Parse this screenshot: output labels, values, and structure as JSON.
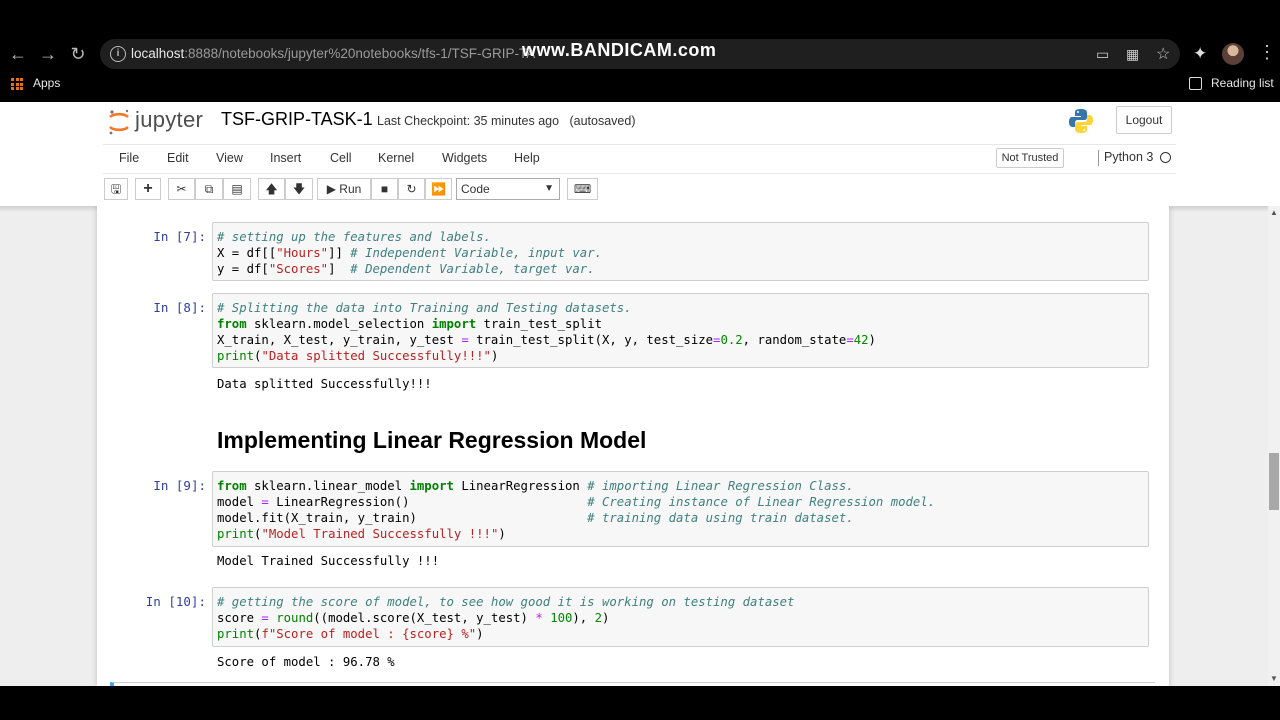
{
  "browser": {
    "url_host": "localhost",
    "url_rest": ":8888/notebooks/jupyter%20notebooks/tfs-1/TSF-GRIP-TA",
    "watermark": "www.BANDICAM.com",
    "bookmarks_apps": "Apps",
    "reading_list": "Reading list",
    "icons": [
      "back-arrow-icon",
      "forward-arrow-icon",
      "reload-icon",
      "site-info-icon",
      "cast-icon",
      "qr-code-icon",
      "bookmark-star-icon",
      "extensions-puzzle-icon",
      "profile-avatar",
      "menu-kebab-icon"
    ]
  },
  "jupyter": {
    "logo_text": "jupyter",
    "notebook_name": "TSF-GRIP-TASK-1",
    "checkpoint": "Last Checkpoint: 35 minutes ago",
    "autosave": "(autosaved)",
    "logout": "Logout",
    "menu": [
      "File",
      "Edit",
      "View",
      "Insert",
      "Cell",
      "Kernel",
      "Widgets",
      "Help"
    ],
    "trust": "Not Trusted",
    "kernel": "Python 3",
    "run_label": "Run",
    "cell_type": "Code"
  },
  "cells": {
    "c7": {
      "prompt": "In [7]:",
      "lines": [
        "# setting up the features and labels.",
        "X = df[[\"Hours\"]] # Independent Variable, input var.",
        "y = df[\"Scores\"]  # Dependent Variable, target var."
      ]
    },
    "c8": {
      "prompt": "In [8]:",
      "lines": [
        "# Splitting the data into Training and Testing datasets.",
        "from sklearn.model_selection import train_test_split",
        "X_train, X_test, y_train, y_test = train_test_split(X, y, test_size=0.2, random_state=42)",
        "print(\"Data splitted Successfully!!!\")"
      ],
      "output": "Data splitted Successfully!!!"
    },
    "heading": "Implementing Linear Regression Model",
    "c9": {
      "prompt": "In [9]:",
      "lines": [
        "from sklearn.linear_model import LinearRegression # importing Linear Regression Class.",
        "model = LinearRegression()                        # Creating instance of Linear Regression model.",
        "model.fit(X_train, y_train)                       # training data using train dataset.",
        "print(\"Model Trained Successfully !!!\")"
      ],
      "output": "Model Trained Successfully !!!"
    },
    "c10": {
      "prompt": "In [10]:",
      "lines": [
        "# getting the score of model, to see how good it is working on testing dataset",
        "score = round((model.score(X_test, y_test) * 100), 2)",
        "print(f\"Score of model : {score} %\")"
      ],
      "output": "Score of model : 96.78 %"
    }
  }
}
